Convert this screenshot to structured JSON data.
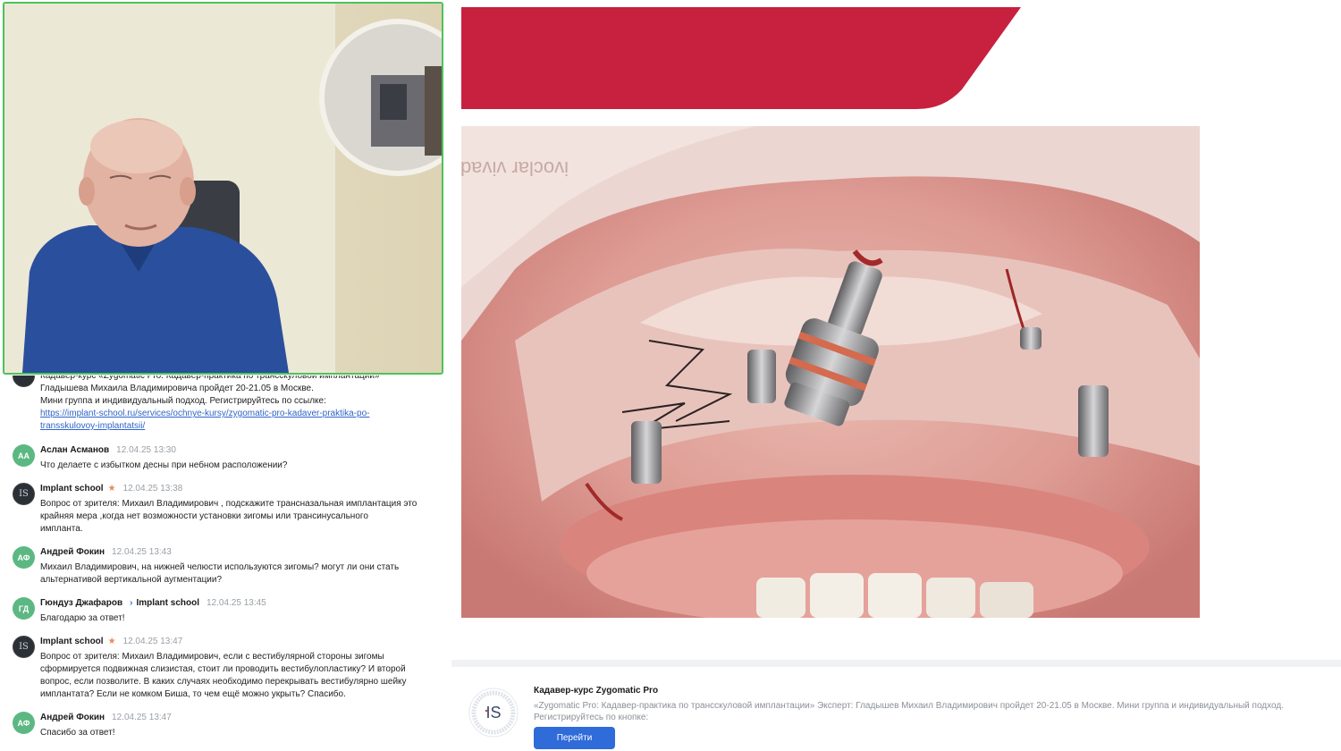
{
  "chat": {
    "messages": [
      {
        "avatar_initials": "",
        "author": "",
        "time": "",
        "text_lines": [
          "Кадавер-курс «Zygomatic Pro: Кадавер-практика по трансскуловой имплантации»",
          "Гладышева Михаила Владимировича пройдет 20-21.05 в Москве.",
          "Мини группа и индивидуальный подход. Регистрируйтесь по ссылке:"
        ],
        "link_lines": [
          "https://implant-school.ru/services/ochnye-kursy/zygomatic-pro-kadaver-praktika-po-",
          "transskulovoy-implantatsii/"
        ]
      },
      {
        "avatar_initials": "АА",
        "author": "Аслан Асманов",
        "time": "12.04.25 13:30",
        "text_lines": [
          "Что делаете с избытком десны при небном расположении?"
        ]
      },
      {
        "avatar_initials": "IS",
        "author": "Implant school",
        "star": "★",
        "time": "12.04.25 13:38",
        "text_lines": [
          "Вопрос от зрителя: Михаил Владимирович , подскажите трансназальная имплантация это",
          "крайняя мера ,когда нет возможности установки зигомы или трансинусального",
          "импланта."
        ]
      },
      {
        "avatar_initials": "АФ",
        "author": "Андрей Фокин",
        "time": "12.04.25 13:43",
        "text_lines": [
          "Михаил Владимирович, на нижней челюсти используются зигомы? могут ли они стать",
          "альтернативой вертикальной аугментации?"
        ]
      },
      {
        "avatar_initials": "ГД",
        "author": "Гюндуз Джафаров",
        "reply_arrow": "›",
        "reply_to": "Implant school",
        "time": "12.04.25 13:45",
        "text_lines": [
          "Благодарю за ответ!"
        ]
      },
      {
        "avatar_initials": "IS",
        "author": "Implant school",
        "star": "★",
        "time": "12.04.25 13:47",
        "text_lines": [
          "Вопрос от зрителя: Михаил Владимирович, если с вестибулярной стороны зигомы",
          "сформируется подвижная слизистая, стоит ли проводить вестибулопластику? И второй",
          "вопрос, если позволите. В каких случаях необходимо перекрывать вестибулярно шейку",
          "имплантата? Если не комком Биша, то чем ещё можно укрыть? Спасибо."
        ]
      },
      {
        "avatar_initials": "АФ",
        "author": "Андрей Фокин",
        "time": "12.04.25 13:47",
        "text_lines": [
          "Спасибо за ответ!"
        ]
      }
    ]
  },
  "slide": {
    "banner_color": "#c8203f",
    "photo_watermark": "ivoclar vivadent"
  },
  "card": {
    "title": "Кадавер-курс Zygomatic Pro",
    "description": "«Zygomatic Pro: Кадавер-практика по трансскуловой имплантации» Эксперт: Гладышев Михаил Владимирович пройдет 20-21.05 в Москве. Мини группа и индивидуальный подход. Регистрируйтесь по кнопке:",
    "button_label": "Перейти",
    "logo_letters": "IS",
    "logo_ring_text": "ШКОЛА ДЕНТАЛЬНОЙ ИМПЛАНТАЦИИ"
  },
  "colors": {
    "accent_blue": "#2f6bd9",
    "active_speaker_border": "#4cc25b"
  }
}
